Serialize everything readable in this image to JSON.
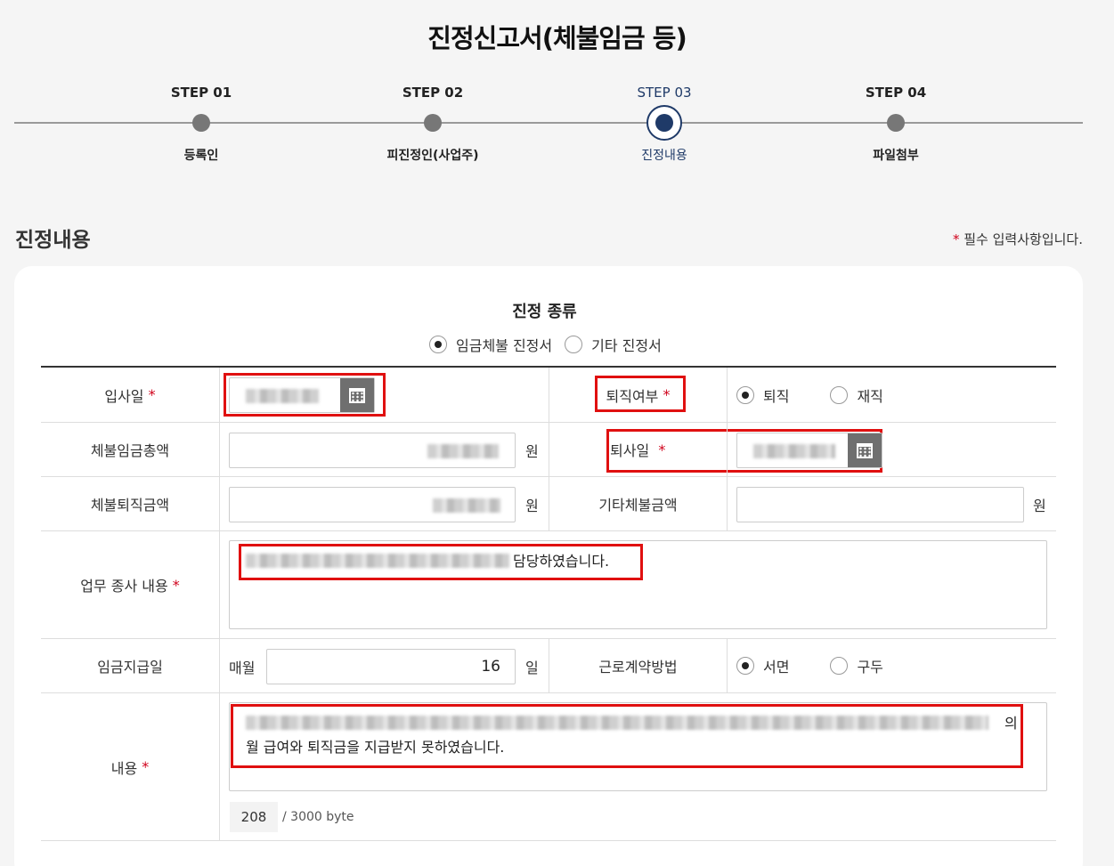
{
  "page": {
    "title": "진정신고서(체불임금 등)"
  },
  "steps": [
    {
      "num": "STEP 01",
      "label": "등록인",
      "active": false
    },
    {
      "num": "STEP 02",
      "label": "피진정인(사업주)",
      "active": false
    },
    {
      "num": "STEP 03",
      "label": "진정내용",
      "active": true
    },
    {
      "num": "STEP 04",
      "label": "파일첨부",
      "active": false
    }
  ],
  "section": {
    "title": "진정내용",
    "required_star": "*",
    "required_note": "필수 입력사항입니다."
  },
  "complaint_type": {
    "title": "진정 종류",
    "options": [
      {
        "label": "임금체불 진정서",
        "checked": true
      },
      {
        "label": "기타 진정서",
        "checked": false
      }
    ]
  },
  "form": {
    "hire_date": {
      "label": "입사일",
      "star": "*"
    },
    "resigned": {
      "label": "퇴직여부",
      "star": "*",
      "options": [
        {
          "label": "퇴직",
          "checked": true
        },
        {
          "label": "재직",
          "checked": false
        }
      ]
    },
    "unpaid_total": {
      "label": "체불임금총액",
      "unit": "원"
    },
    "leave_date": {
      "label": "퇴사일",
      "star": "*"
    },
    "unpaid_severance": {
      "label": "체불퇴직금액",
      "unit": "원"
    },
    "other_unpaid": {
      "label": "기타체불금액",
      "unit": "원",
      "value": ""
    },
    "work_desc": {
      "label": "업무 종사 내용",
      "star": "*",
      "visible_text": "담당하였습니다."
    },
    "pay_day": {
      "label": "임금지급일",
      "prefix": "매월",
      "value": "16",
      "unit": "일"
    },
    "contract_method": {
      "label": "근로계약방법",
      "options": [
        {
          "label": "서면",
          "checked": true
        },
        {
          "label": "구두",
          "checked": false
        }
      ]
    },
    "content": {
      "label": "내용",
      "star": "*",
      "line1_end": "의",
      "line2": "월 급여와 퇴직금을 지급받지 못하였습니다.",
      "byte_count": "208",
      "byte_total": "/ 3000 byte"
    }
  },
  "colors": {
    "accent": "#1f3a68",
    "required": "#d0021b",
    "highlight": "#e01010"
  }
}
